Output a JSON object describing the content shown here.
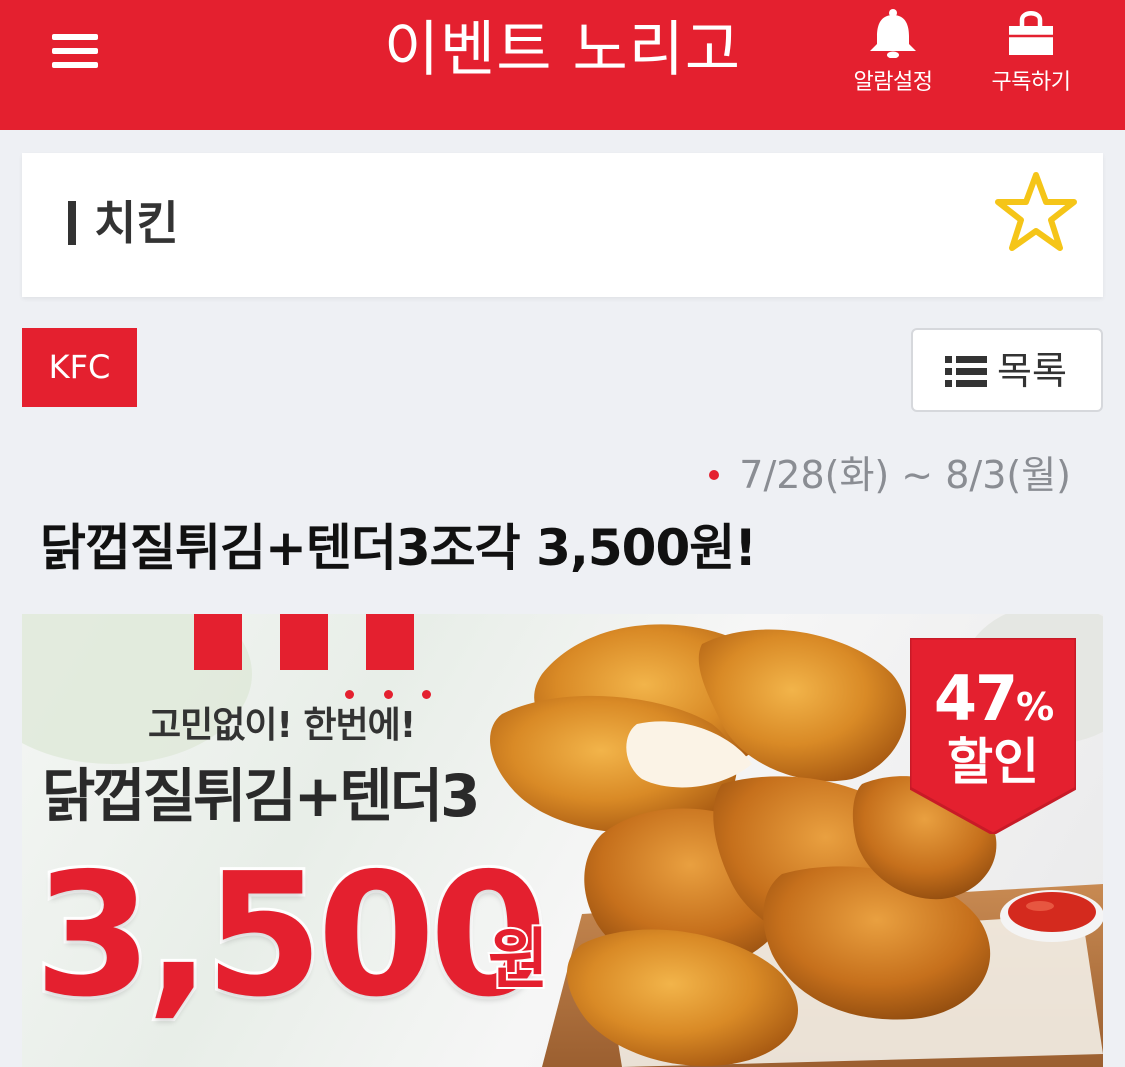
{
  "header": {
    "title": "이벤트 노리고",
    "alarm_label": "알람설정",
    "subscribe_label": "구독하기",
    "accent_color": "#e4202f"
  },
  "category": {
    "title": "치킨",
    "favorite_icon": "star-outline-icon"
  },
  "brand": {
    "name": "KFC"
  },
  "list_button": {
    "label": "목록",
    "icon": "list-icon"
  },
  "event": {
    "date_range": "7/28(화) ~ 8/3(월)",
    "title": "닭껍질튀김+텐더3조각 3,500원!"
  },
  "banner": {
    "subtitle": "고민없이! 한번에!",
    "product": "닭껍질튀김+텐더3",
    "price": "3,500",
    "currency": "원",
    "discount_percent": "47",
    "discount_symbol": "%",
    "discount_label": "할인"
  }
}
